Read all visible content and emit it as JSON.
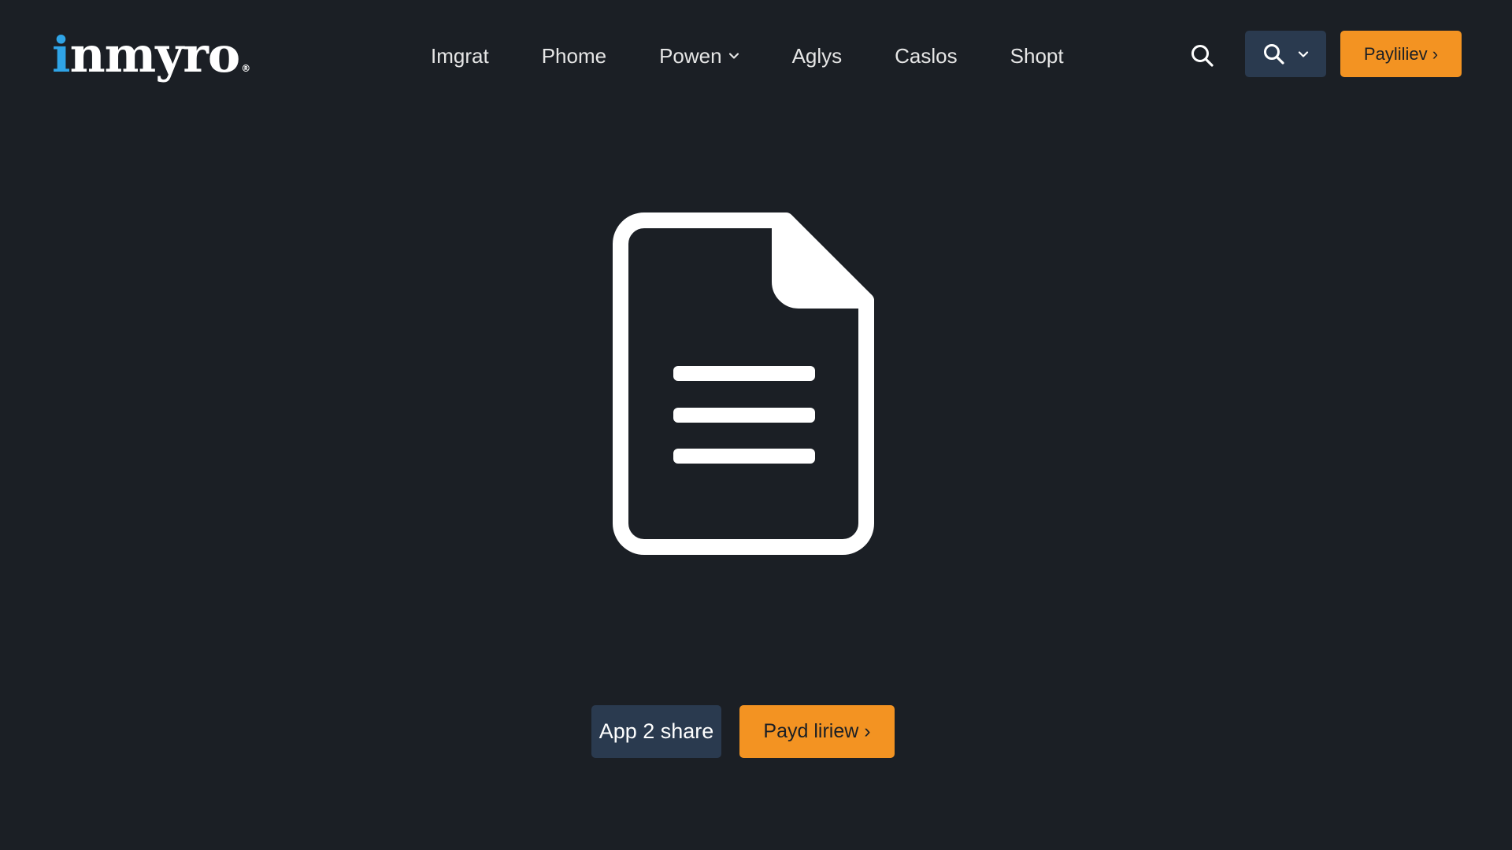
{
  "brand": {
    "logo_first_letter": "i",
    "logo_rest": "nmyro",
    "logo_mark": "®",
    "accent_color": "#2fa4e7"
  },
  "nav": {
    "items": [
      {
        "label": "Imgrat"
      },
      {
        "label": "Phome"
      },
      {
        "label": "Powen",
        "has_dropdown": true
      },
      {
        "label": "Aglys"
      },
      {
        "label": "Caslos"
      },
      {
        "label": "Shopt"
      }
    ]
  },
  "header": {
    "search_icon": "search-icon",
    "search_dropdown_icon": "search-icon",
    "search_dropdown_chevron": "chevron-down-icon",
    "cta_label": "Payliliev ›"
  },
  "main": {
    "hero_icon": "document-icon"
  },
  "actions": {
    "primary_label": "App 2 share",
    "secondary_label": "Payd liriew ›"
  },
  "colors": {
    "background": "#1b1f25",
    "dark_button": "#2a3a4f",
    "orange_button": "#f39322"
  }
}
